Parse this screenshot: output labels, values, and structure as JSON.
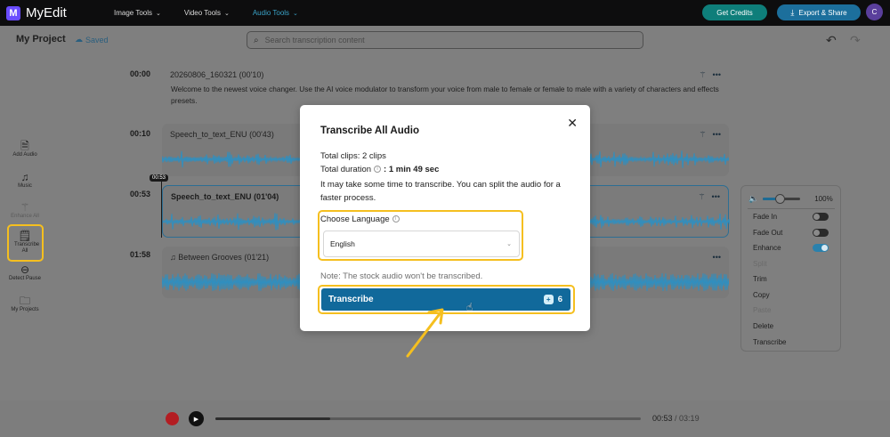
{
  "app": {
    "name": "MyEdit",
    "logo_letter": "M"
  },
  "nav": [
    {
      "label": "Image Tools",
      "active": false
    },
    {
      "label": "Video Tools",
      "active": false
    },
    {
      "label": "Audio Tools",
      "active": true
    }
  ],
  "header": {
    "credits_label": "Get Credits",
    "export_label": "Export & Share",
    "avatar_letter": "C"
  },
  "project": {
    "title": "My Project",
    "saved_label": "Saved"
  },
  "search": {
    "placeholder": "Search transcription content"
  },
  "sidebar": [
    {
      "label": "Add Audio",
      "icon": "add-audio-icon",
      "enabled": true
    },
    {
      "label": "Music",
      "icon": "music-icon",
      "enabled": true
    },
    {
      "label": "Enhance All",
      "icon": "magic-wand-icon",
      "enabled": false
    },
    {
      "label": "Transcribe All",
      "icon": "transcribe-icon",
      "enabled": true,
      "highlighted": true
    },
    {
      "label": "Detect Pause",
      "icon": "pause-icon",
      "enabled": true
    },
    {
      "label": "My Projects",
      "icon": "folder-icon",
      "enabled": true
    }
  ],
  "timeline": {
    "playhead_label": "00:53",
    "clips": [
      {
        "time": "00:00",
        "name": "20260806_160321",
        "duration": "(00'10)",
        "text": "Welcome to the newest voice changer. Use the AI voice modulator to transform your voice from male to female or female to male with a variety of characters and effects presets."
      },
      {
        "time": "00:10",
        "name": "Speech_to_text_ENU",
        "duration": "(00'43)"
      },
      {
        "time": "00:53",
        "name": "Speech_to_text_ENU",
        "duration": "(01'04)",
        "selected": true
      },
      {
        "time": "01:58",
        "name": "Between Grooves",
        "duration": "(01'21)",
        "music": true
      }
    ]
  },
  "right_panel": {
    "volume_value": "100%",
    "volume_level": 0.45,
    "items": [
      {
        "label": "Fade In",
        "toggle": "off"
      },
      {
        "label": "Fade Out",
        "toggle": "off"
      },
      {
        "label": "Enhance",
        "toggle": "on"
      },
      {
        "label": "Split",
        "enabled": false
      },
      {
        "label": "Trim",
        "enabled": true
      },
      {
        "label": "Copy",
        "enabled": true
      },
      {
        "label": "Paste",
        "enabled": false
      },
      {
        "label": "Delete",
        "enabled": true
      },
      {
        "label": "Transcribe",
        "enabled": true
      }
    ]
  },
  "player": {
    "current": "00:53",
    "total": "/ 03:19",
    "progress": 0.27
  },
  "modal": {
    "title": "Transcribe All Audio",
    "total_clips_label": "Total clips: 2 clips",
    "total_duration_label": "Total duration",
    "total_duration_value": ": 1 min 49 sec",
    "wait_text": "It may take some time to transcribe. You can split the audio for a faster process.",
    "language_label": "Choose Language",
    "language_value": "English",
    "note": "Note: The stock audio won't be transcribed.",
    "button_label": "Transcribe",
    "button_cost": "6"
  },
  "colors": {
    "accent": "#11699b",
    "highlight": "#f5bf1f",
    "audio_tools": "#3aa3c8",
    "credits": "#0e7e7a"
  }
}
